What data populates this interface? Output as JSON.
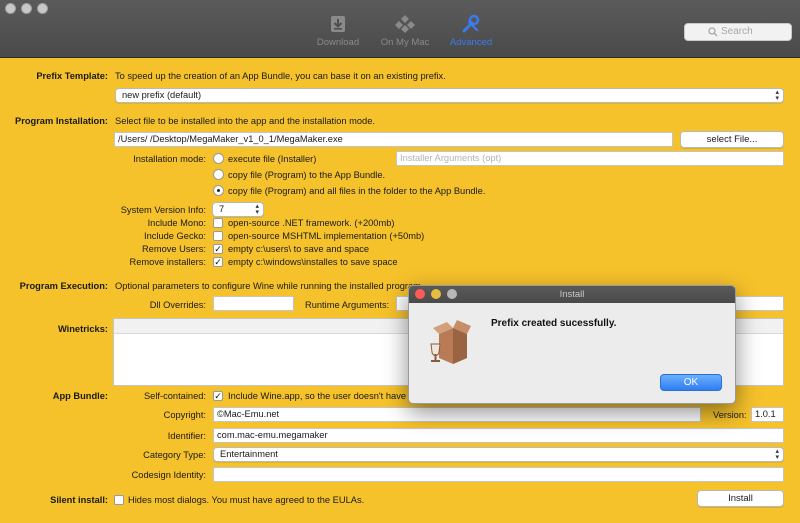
{
  "toolbar": {
    "download_label": "Download",
    "on_my_mac_label": "On My Mac",
    "advanced_label": "Advanced",
    "search_placeholder": "Search"
  },
  "prefix": {
    "section_label": "Prefix Template:",
    "description": "To speed up the creation of an App Bundle, you can base it on an existing prefix.",
    "selected": "new prefix (default)"
  },
  "install": {
    "section_label": "Program Installation:",
    "description": "Select file to be installed into the app and the installation mode.",
    "file_path": "/Users/            /Desktop/MegaMaker_v1_0_1/MegaMaker.exe",
    "select_button": "select File...",
    "mode_label": "Installation mode:",
    "mode_options": [
      {
        "label": "execute file (Installer)",
        "selected": false
      },
      {
        "label": "copy file (Program)  to the App Bundle.",
        "selected": false
      },
      {
        "label": "copy file (Program)  and all files in the folder to the App Bundle.",
        "selected": true
      }
    ],
    "installer_args_placeholder": "Installer Arguments (opt)",
    "sysver_label": "System Version Info:",
    "sysver_value": "7",
    "options": [
      {
        "label": "Include Mono:",
        "text": "open-source .NET framework. (+200mb)",
        "checked": false
      },
      {
        "label": "Include Gecko:",
        "text": "open-source MSHTML implementation (+50mb)",
        "checked": false
      },
      {
        "label": "Remove Users:",
        "text": "empty c:\\users\\ to save and space",
        "checked": true
      },
      {
        "label": "Remove installers:",
        "text": "empty c:\\windows\\installes to save space",
        "checked": true
      }
    ]
  },
  "execution": {
    "section_label": "Program Execution:",
    "description": "Optional parameters to configure Wine while running the installed program",
    "dll_label": "Dll Overrides:",
    "dll_value": "",
    "runtime_label": "Runtime Arguments:",
    "runtime_value": ""
  },
  "winetricks": {
    "label": "Winetricks:"
  },
  "bundle": {
    "section_label": "App Bundle:",
    "self_contained_label": "Self-contained:",
    "self_contained_text": "Include Wine.app, so the user doesn't have",
    "self_contained_checked": true,
    "copyright_label": "Copyright:",
    "copyright_value": "©Mac-Emu.net",
    "version_label": "Version:",
    "version_value": "1.0.1",
    "identifier_label": "Identifier:",
    "identifier_value": "com.mac-emu.megamaker",
    "category_label": "Category Type:",
    "category_value": "Entertainment",
    "codesign_label": "Codesign Identity:",
    "codesign_value": ""
  },
  "silent": {
    "section_label": "Silent install:",
    "text": "Hides most dialogs. You must have agreed to the EULAs.",
    "checked": false,
    "install_button": "Install"
  },
  "dialog": {
    "title": "Install",
    "message": "Prefix created sucessfully.",
    "ok_label": "OK"
  },
  "colors": {
    "background": "#f6c22b",
    "accent": "#3b7bf0",
    "titlebar": "#4e4e4e"
  }
}
